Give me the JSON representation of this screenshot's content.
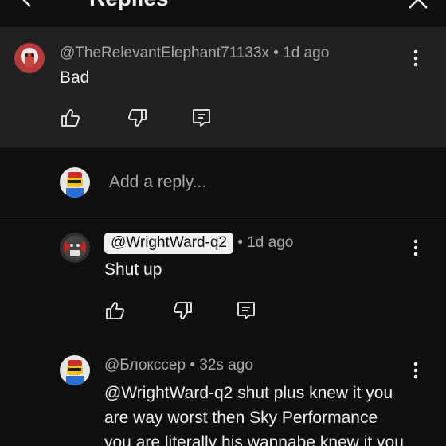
{
  "header": {
    "title": "Replies"
  },
  "parent_comment": {
    "handle": "@TheRelevantElephant71133x",
    "separator": "•",
    "time": "1d ago",
    "text": "Bad"
  },
  "reply_input": {
    "placeholder": "Add a reply..."
  },
  "replies": [
    {
      "handle": "@WrightWard-q2",
      "separator": "•",
      "time": "1d ago",
      "text": "Shut up"
    },
    {
      "handle": "@Блокссер",
      "separator": "•",
      "time": "32s ago",
      "text_lines": [
        "@WrightWard-q2 shut plus knew it you",
        "are way worst then Sky Performance",
        "you are literally his wannabe knew it you"
      ]
    }
  ],
  "colors": {
    "background": "#0f0f0f",
    "highlight_bg": "#212121",
    "text": "#f1f1f1",
    "secondary_text": "#aaaaaa"
  },
  "icons": {
    "back": "back-arrow-icon",
    "close": "close-icon",
    "more": "more-vertical-icon",
    "like": "thumb-up-icon",
    "dislike": "thumb-down-icon",
    "reply": "reply-comment-icon"
  }
}
